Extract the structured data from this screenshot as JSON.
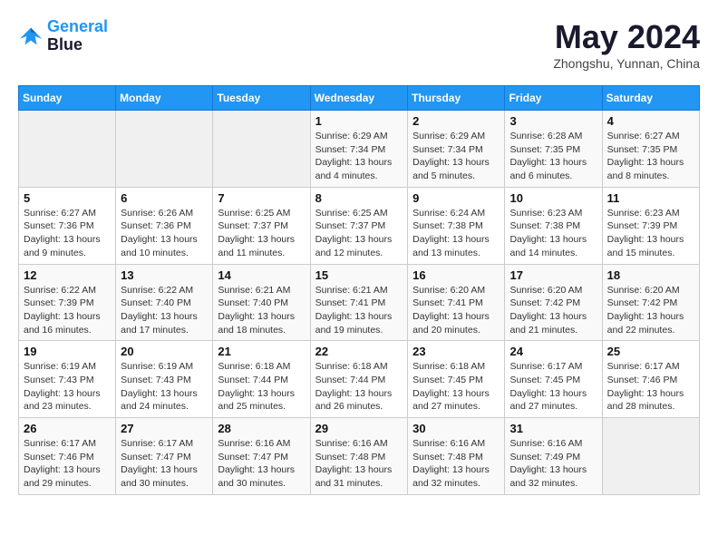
{
  "logo": {
    "line1": "General",
    "line2": "Blue"
  },
  "title": "May 2024",
  "subtitle": "Zhongshu, Yunnan, China",
  "days_header": [
    "Sunday",
    "Monday",
    "Tuesday",
    "Wednesday",
    "Thursday",
    "Friday",
    "Saturday"
  ],
  "weeks": [
    [
      {
        "day": "",
        "info": ""
      },
      {
        "day": "",
        "info": ""
      },
      {
        "day": "",
        "info": ""
      },
      {
        "day": "1",
        "info": "Sunrise: 6:29 AM\nSunset: 7:34 PM\nDaylight: 13 hours\nand 4 minutes."
      },
      {
        "day": "2",
        "info": "Sunrise: 6:29 AM\nSunset: 7:34 PM\nDaylight: 13 hours\nand 5 minutes."
      },
      {
        "day": "3",
        "info": "Sunrise: 6:28 AM\nSunset: 7:35 PM\nDaylight: 13 hours\nand 6 minutes."
      },
      {
        "day": "4",
        "info": "Sunrise: 6:27 AM\nSunset: 7:35 PM\nDaylight: 13 hours\nand 8 minutes."
      }
    ],
    [
      {
        "day": "5",
        "info": "Sunrise: 6:27 AM\nSunset: 7:36 PM\nDaylight: 13 hours\nand 9 minutes."
      },
      {
        "day": "6",
        "info": "Sunrise: 6:26 AM\nSunset: 7:36 PM\nDaylight: 13 hours\nand 10 minutes."
      },
      {
        "day": "7",
        "info": "Sunrise: 6:25 AM\nSunset: 7:37 PM\nDaylight: 13 hours\nand 11 minutes."
      },
      {
        "day": "8",
        "info": "Sunrise: 6:25 AM\nSunset: 7:37 PM\nDaylight: 13 hours\nand 12 minutes."
      },
      {
        "day": "9",
        "info": "Sunrise: 6:24 AM\nSunset: 7:38 PM\nDaylight: 13 hours\nand 13 minutes."
      },
      {
        "day": "10",
        "info": "Sunrise: 6:23 AM\nSunset: 7:38 PM\nDaylight: 13 hours\nand 14 minutes."
      },
      {
        "day": "11",
        "info": "Sunrise: 6:23 AM\nSunset: 7:39 PM\nDaylight: 13 hours\nand 15 minutes."
      }
    ],
    [
      {
        "day": "12",
        "info": "Sunrise: 6:22 AM\nSunset: 7:39 PM\nDaylight: 13 hours\nand 16 minutes."
      },
      {
        "day": "13",
        "info": "Sunrise: 6:22 AM\nSunset: 7:40 PM\nDaylight: 13 hours\nand 17 minutes."
      },
      {
        "day": "14",
        "info": "Sunrise: 6:21 AM\nSunset: 7:40 PM\nDaylight: 13 hours\nand 18 minutes."
      },
      {
        "day": "15",
        "info": "Sunrise: 6:21 AM\nSunset: 7:41 PM\nDaylight: 13 hours\nand 19 minutes."
      },
      {
        "day": "16",
        "info": "Sunrise: 6:20 AM\nSunset: 7:41 PM\nDaylight: 13 hours\nand 20 minutes."
      },
      {
        "day": "17",
        "info": "Sunrise: 6:20 AM\nSunset: 7:42 PM\nDaylight: 13 hours\nand 21 minutes."
      },
      {
        "day": "18",
        "info": "Sunrise: 6:20 AM\nSunset: 7:42 PM\nDaylight: 13 hours\nand 22 minutes."
      }
    ],
    [
      {
        "day": "19",
        "info": "Sunrise: 6:19 AM\nSunset: 7:43 PM\nDaylight: 13 hours\nand 23 minutes."
      },
      {
        "day": "20",
        "info": "Sunrise: 6:19 AM\nSunset: 7:43 PM\nDaylight: 13 hours\nand 24 minutes."
      },
      {
        "day": "21",
        "info": "Sunrise: 6:18 AM\nSunset: 7:44 PM\nDaylight: 13 hours\nand 25 minutes."
      },
      {
        "day": "22",
        "info": "Sunrise: 6:18 AM\nSunset: 7:44 PM\nDaylight: 13 hours\nand 26 minutes."
      },
      {
        "day": "23",
        "info": "Sunrise: 6:18 AM\nSunset: 7:45 PM\nDaylight: 13 hours\nand 27 minutes."
      },
      {
        "day": "24",
        "info": "Sunrise: 6:17 AM\nSunset: 7:45 PM\nDaylight: 13 hours\nand 27 minutes."
      },
      {
        "day": "25",
        "info": "Sunrise: 6:17 AM\nSunset: 7:46 PM\nDaylight: 13 hours\nand 28 minutes."
      }
    ],
    [
      {
        "day": "26",
        "info": "Sunrise: 6:17 AM\nSunset: 7:46 PM\nDaylight: 13 hours\nand 29 minutes."
      },
      {
        "day": "27",
        "info": "Sunrise: 6:17 AM\nSunset: 7:47 PM\nDaylight: 13 hours\nand 30 minutes."
      },
      {
        "day": "28",
        "info": "Sunrise: 6:16 AM\nSunset: 7:47 PM\nDaylight: 13 hours\nand 30 minutes."
      },
      {
        "day": "29",
        "info": "Sunrise: 6:16 AM\nSunset: 7:48 PM\nDaylight: 13 hours\nand 31 minutes."
      },
      {
        "day": "30",
        "info": "Sunrise: 6:16 AM\nSunset: 7:48 PM\nDaylight: 13 hours\nand 32 minutes."
      },
      {
        "day": "31",
        "info": "Sunrise: 6:16 AM\nSunset: 7:49 PM\nDaylight: 13 hours\nand 32 minutes."
      },
      {
        "day": "",
        "info": ""
      }
    ]
  ]
}
